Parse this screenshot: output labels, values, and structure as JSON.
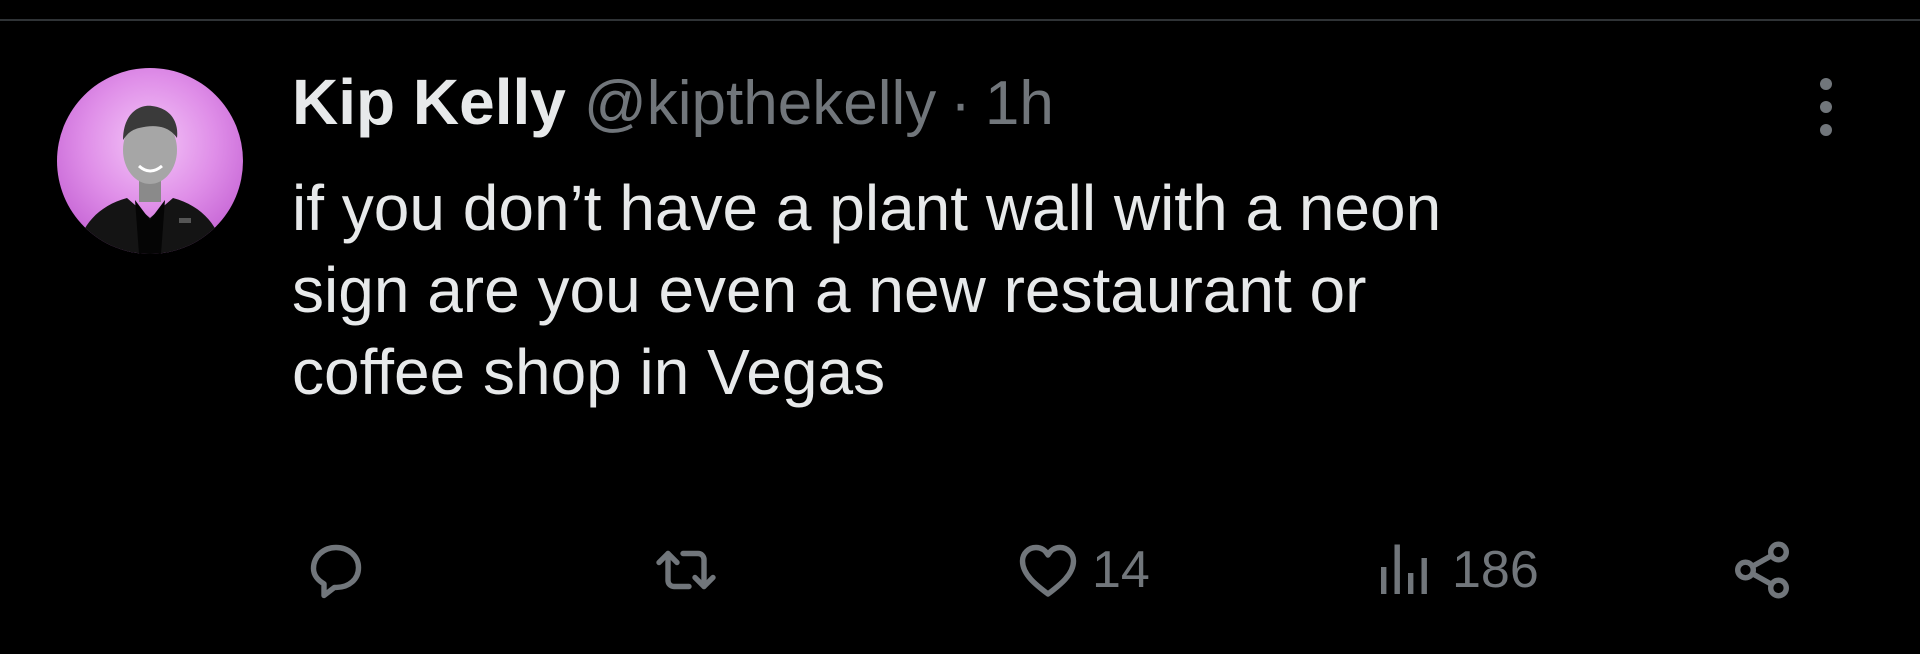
{
  "tweet": {
    "author": {
      "display_name": "Kip Kelly",
      "handle": "@kipthekelly"
    },
    "separator": "·",
    "time": "1h",
    "text": "if you don’t have a plant wall with a neon\nsign are you even a new restaurant or\ncoffee shop in Vegas",
    "actions": {
      "reply": {
        "icon": "reply-icon"
      },
      "retweet": {
        "icon": "retweet-icon"
      },
      "like": {
        "icon": "heart-icon",
        "count": "14"
      },
      "views": {
        "icon": "views-icon",
        "count": "186"
      },
      "share": {
        "icon": "share-icon"
      }
    }
  },
  "colors": {
    "background": "#000000",
    "primary_text": "#e7e9ea",
    "secondary_text": "#71767b",
    "divider": "#2f3336",
    "avatar_accent": "#d27ee0"
  }
}
